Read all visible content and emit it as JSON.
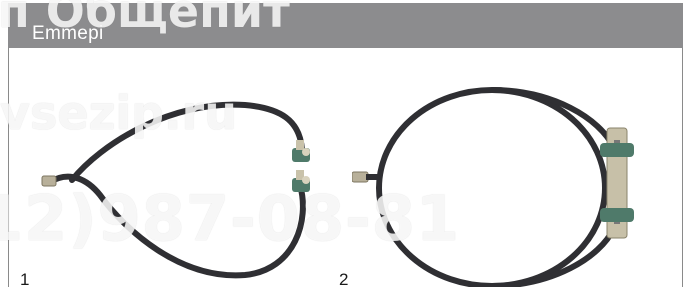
{
  "header": {
    "brand": "Emmepi"
  },
  "watermarks": {
    "top": "п Общепит",
    "middle": "vsezip.ru",
    "phone": "12)987-08-81"
  },
  "figures": [
    {
      "number": "1",
      "icon": "heating-element-tubular-icon"
    },
    {
      "number": "2",
      "icon": "heating-element-ring-icon"
    }
  ],
  "colors": {
    "header_bg": "#8c8c8e",
    "element": "#2f2f33",
    "terminal": "#b8b09a"
  }
}
